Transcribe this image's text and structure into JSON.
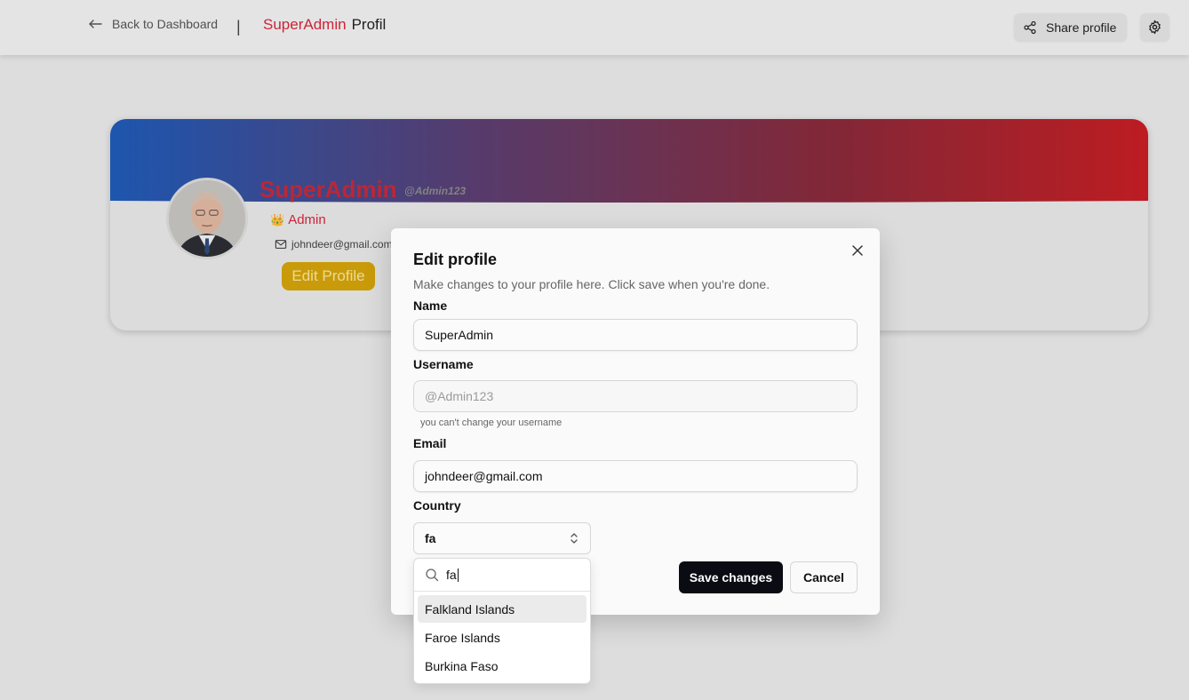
{
  "header": {
    "back_label": "Back to Dashboard",
    "separator": "|",
    "brand_red": "SuperAdmin",
    "brand_dark": "Profil",
    "share_label": "Share profile",
    "share_icon": "share-icon",
    "settings_icon": "gear-icon"
  },
  "profile": {
    "name": "SuperAdmin",
    "handle": "@Admin123",
    "role": "Admin",
    "role_icon": "👑",
    "email": "johndeer@gmail.com",
    "edit_label": "Edit Profile",
    "banner_colors": [
      "#1f5bb8",
      "#5b3f72",
      "#8a2a3a",
      "#c81e24"
    ]
  },
  "dialog": {
    "title": "Edit profile",
    "description": "Make changes to your profile here. Click save when you're done.",
    "name_label": "Name",
    "name_value": "SuperAdmin",
    "username_label": "Username",
    "username_value": "@Admin123",
    "username_hint": "you can't change your username",
    "email_label": "Email",
    "email_value": "johndeer@gmail.com",
    "country_label": "Country",
    "country_value": "fa",
    "save_label": "Save changes",
    "cancel_label": "Cancel"
  },
  "country_dropdown": {
    "search_value": "fa",
    "options": [
      "Falkland Islands",
      "Faroe Islands",
      "Burkina Faso"
    ],
    "highlighted": "Falkland Islands"
  }
}
